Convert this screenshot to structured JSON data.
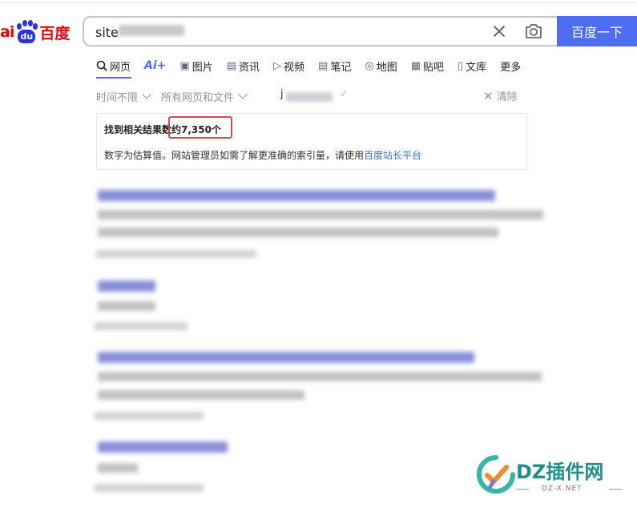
{
  "logo": {
    "brand_left": "ai",
    "paw_text": "du",
    "brand_cn": "百度"
  },
  "search": {
    "query": "site",
    "button_label": "百度一下"
  },
  "tabs": [
    {
      "label": "网页",
      "icon": "search-icon"
    },
    {
      "label": "",
      "icon": "ai-icon",
      "ai_text": "Ai+"
    },
    {
      "label": "图片",
      "icon": "image-icon"
    },
    {
      "label": "资讯",
      "icon": "news-icon"
    },
    {
      "label": "视频",
      "icon": "video-icon"
    },
    {
      "label": "笔记",
      "icon": "note-icon"
    },
    {
      "label": "地图",
      "icon": "map-icon"
    },
    {
      "label": "贴吧",
      "icon": "tieba-icon"
    },
    {
      "label": "文库",
      "icon": "doc-icon"
    },
    {
      "label": "更多",
      "icon": ""
    }
  ],
  "filters": {
    "time": "时间不限",
    "scope": "所有网页和文件",
    "site_prefix": "j",
    "clear": "清除"
  },
  "result_count": {
    "prefix": "找到相关结果数",
    "count": "约7,350个",
    "note": "数字为估算值。网站管理员如需了解更准确的索引量，请使用",
    "note_link": "百度站长平台"
  },
  "watermark": {
    "main": "DZ插件网",
    "sub": "DZ-X.NET"
  },
  "colors": {
    "accent": "#4e6ef2",
    "highlight": "#d9474e",
    "logo_red": "#e10601",
    "logo_blue": "#2932e1"
  }
}
